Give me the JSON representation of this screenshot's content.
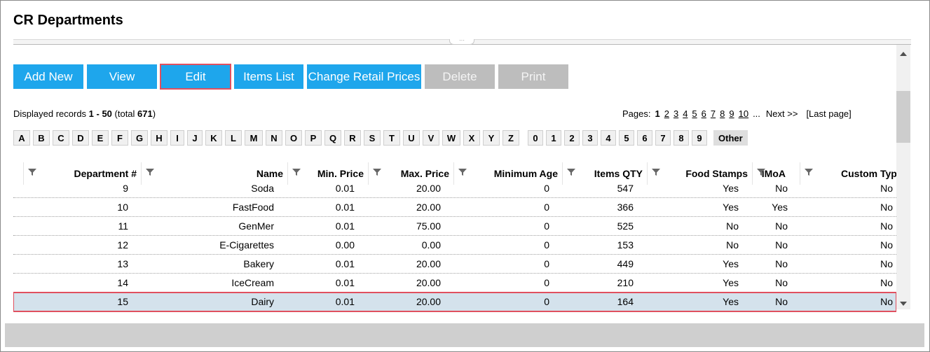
{
  "page": {
    "title": "CR Departments"
  },
  "colors": {
    "accent": "#1ea6ec",
    "disabled": "#bdbdbd",
    "highlight": "#e0505f",
    "selected_row": "#d4e2ec"
  },
  "toolbar": {
    "add_new": "Add New",
    "view": "View",
    "edit": "Edit",
    "items_list": "Items List",
    "change_retail_prices": "Change Retail Prices",
    "delete": "Delete",
    "print": "Print"
  },
  "records": {
    "prefix": "Displayed records ",
    "range": "1 - 50",
    "total_prefix": " (total ",
    "total": "671",
    "total_suffix": ")"
  },
  "pager": {
    "label": "Pages:",
    "current": "1",
    "pages": [
      "2",
      "3",
      "4",
      "5",
      "6",
      "7",
      "8",
      "9",
      "10"
    ],
    "ellipsis": "...",
    "next": "Next >>",
    "last": "[Last page]"
  },
  "alpha": {
    "letters": [
      "A",
      "B",
      "C",
      "D",
      "E",
      "F",
      "G",
      "H",
      "I",
      "J",
      "K",
      "L",
      "M",
      "N",
      "O",
      "P",
      "Q",
      "R",
      "S",
      "T",
      "U",
      "V",
      "W",
      "X",
      "Y",
      "Z"
    ],
    "digits": [
      "0",
      "1",
      "2",
      "3",
      "4",
      "5",
      "6",
      "7",
      "8",
      "9"
    ],
    "other": "Other"
  },
  "grid": {
    "headers": {
      "department": "Department #",
      "name": "Name",
      "min_price": "Min. Price",
      "max_price": "Max. Price",
      "min_age": "Minimum Age",
      "items_qty": "Items QTY",
      "food_stamps": "Food Stamps",
      "imoa": "IMoA",
      "custom_type": "Custom Type"
    },
    "rows": [
      {
        "dept": "9",
        "name": "Soda",
        "min": "0.01",
        "max": "20.00",
        "age": "0",
        "qty": "547",
        "fs": "Yes",
        "imoa": "No",
        "ct": "No"
      },
      {
        "dept": "10",
        "name": "FastFood",
        "min": "0.01",
        "max": "20.00",
        "age": "0",
        "qty": "366",
        "fs": "Yes",
        "imoa": "Yes",
        "ct": "No"
      },
      {
        "dept": "11",
        "name": "GenMer",
        "min": "0.01",
        "max": "75.00",
        "age": "0",
        "qty": "525",
        "fs": "No",
        "imoa": "No",
        "ct": "No"
      },
      {
        "dept": "12",
        "name": "E-Cigarettes",
        "min": "0.00",
        "max": "0.00",
        "age": "0",
        "qty": "153",
        "fs": "No",
        "imoa": "No",
        "ct": "No"
      },
      {
        "dept": "13",
        "name": "Bakery",
        "min": "0.01",
        "max": "20.00",
        "age": "0",
        "qty": "449",
        "fs": "Yes",
        "imoa": "No",
        "ct": "No"
      },
      {
        "dept": "14",
        "name": "IceCream",
        "min": "0.01",
        "max": "20.00",
        "age": "0",
        "qty": "210",
        "fs": "Yes",
        "imoa": "No",
        "ct": "No"
      },
      {
        "dept": "15",
        "name": "Dairy",
        "min": "0.01",
        "max": "20.00",
        "age": "0",
        "qty": "164",
        "fs": "Yes",
        "imoa": "No",
        "ct": "No"
      }
    ]
  }
}
